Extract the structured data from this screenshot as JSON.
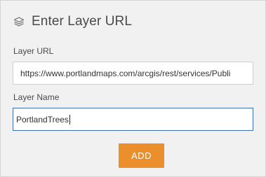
{
  "header": {
    "icon": "layers-icon",
    "title": "Enter Layer URL"
  },
  "layer_url": {
    "label": "Layer URL",
    "value": "https://www.portlandmaps.com/arcgis/rest/services/Publi"
  },
  "layer_name": {
    "label": "Layer Name",
    "value": "PortlandTrees"
  },
  "actions": {
    "add_label": "ADD"
  },
  "colors": {
    "accent": "#ea8f2c",
    "focus_border": "#3c6fb6",
    "panel_bg": "#f1f1f1"
  }
}
